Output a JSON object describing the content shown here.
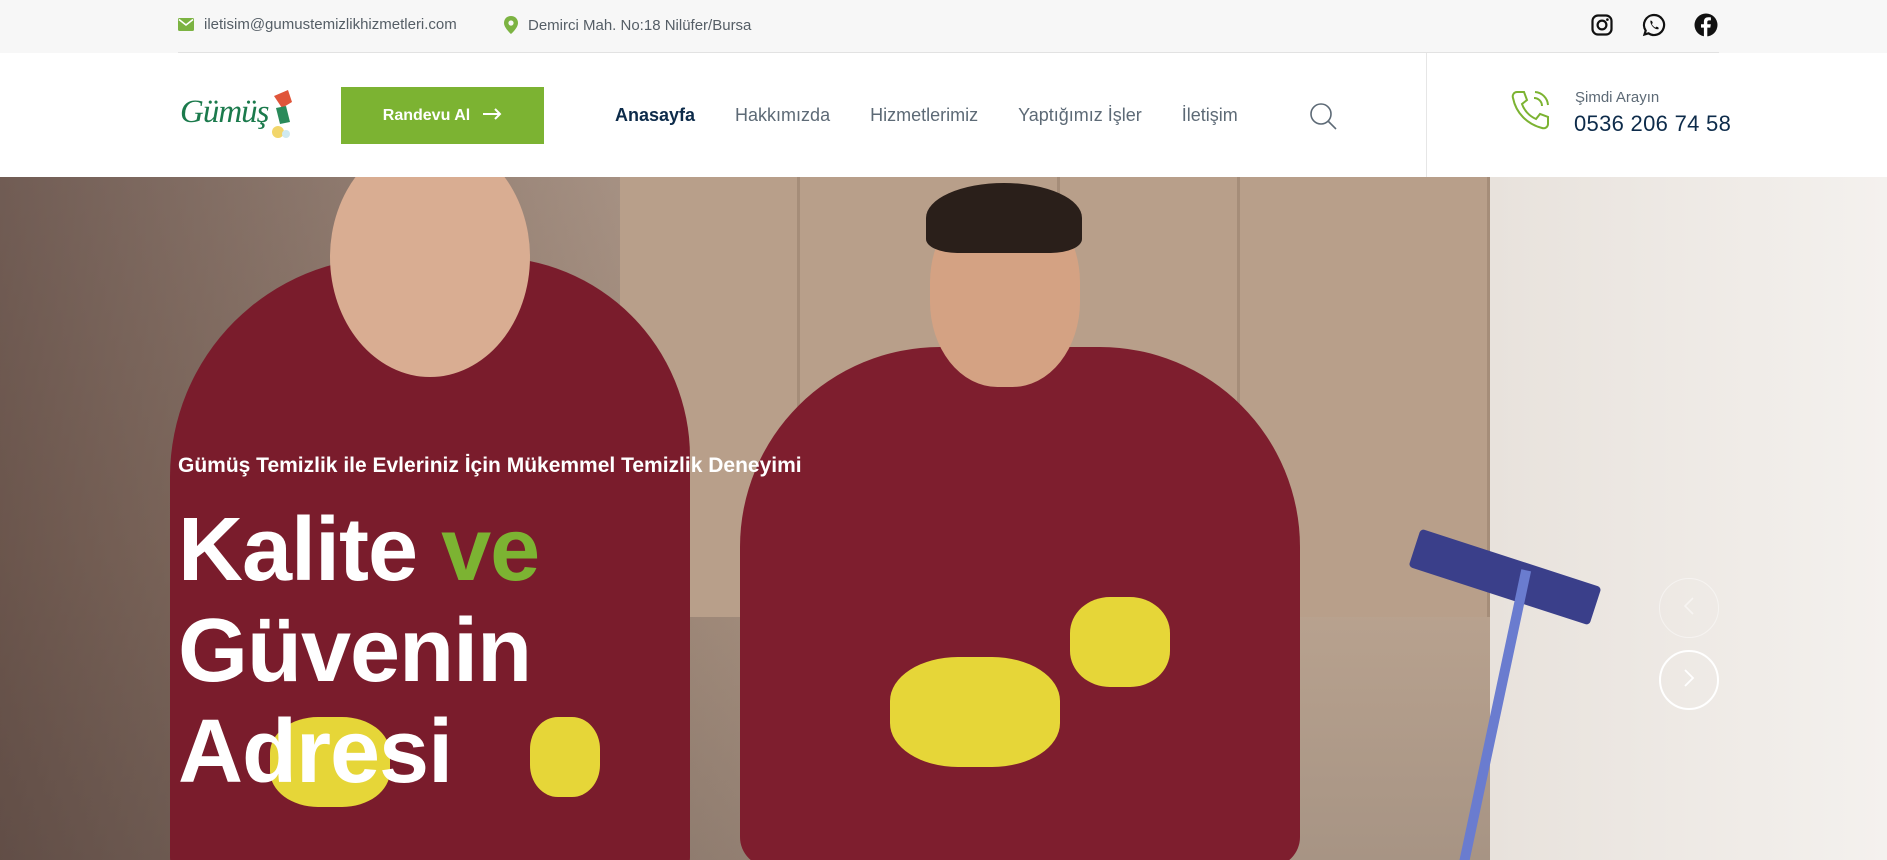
{
  "topbar": {
    "email": "iletisim@gumustemizlikhizmetleri.com",
    "address": "Demirci Mah. No:18 Nilüfer/Bursa",
    "socials": [
      "instagram-icon",
      "whatsapp-icon",
      "facebook-icon"
    ]
  },
  "header": {
    "logo_text": "Gümüş",
    "cta_label": "Randevu Al",
    "menu": [
      {
        "label": "Anasayfa",
        "active": true
      },
      {
        "label": "Hakkımızda",
        "active": false
      },
      {
        "label": "Hizmetlerimiz",
        "active": false
      },
      {
        "label": "Yaptığımız İşler",
        "active": false
      },
      {
        "label": "İletişim",
        "active": false
      }
    ],
    "call_label": "Şimdi Arayın",
    "call_number": "0536 206 74 58"
  },
  "hero": {
    "subtitle": "Gümüş Temizlik ile Evleriniz İçin Mükemmel Temizlik Deneyimi",
    "title_line1_word1": "Kalite",
    "title_line1_accent": "ve",
    "title_line2": "Güvenin",
    "title_line3": "Adresi"
  },
  "colors": {
    "accent": "#7cb332",
    "navy": "#0d2b4a",
    "muted": "#5d6a76"
  }
}
